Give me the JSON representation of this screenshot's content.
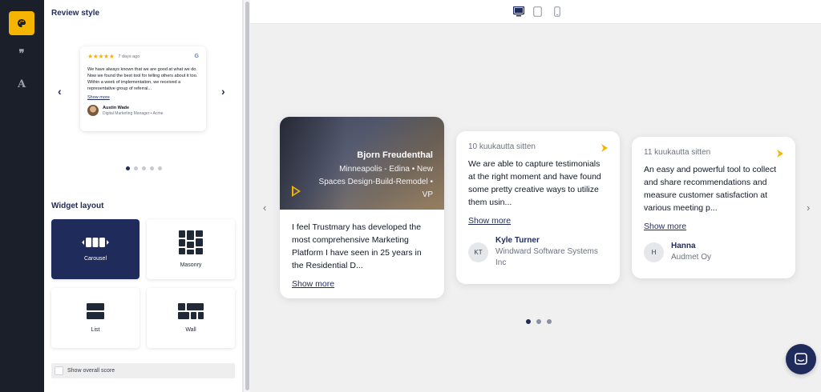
{
  "colors": {
    "accent": "#f5b400",
    "navy": "#1f2b5b",
    "rail": "#1b1f2a"
  },
  "rail": {
    "items": [
      "palette-icon",
      "quote-icon",
      "font-icon"
    ],
    "quote_glyph": "❞",
    "font_glyph": "A"
  },
  "sidebar": {
    "review_style_title": "Review style",
    "preview": {
      "stars": "★★★★★",
      "time": "7 days ago",
      "source": "G",
      "text": "We have always known that we are good at what we do. Now we found the best tool for telling others about it too. Within a week of implementation, we received a representative group of referral...",
      "show_more": "Show more",
      "author_name": "Austin Wade",
      "author_role": "Digital Marketing Manager • Acme",
      "prev": "‹",
      "next": "›",
      "dots": 5,
      "active_dot": 0
    },
    "widget_layout_title": "Widget layout",
    "layouts": [
      {
        "label": "Carousel",
        "active": true
      },
      {
        "label": "Masonry",
        "active": false
      },
      {
        "label": "List",
        "active": false
      },
      {
        "label": "Wall",
        "active": false
      }
    ],
    "show_overall_score": "Show overall score"
  },
  "toolbar": {
    "devices": [
      "desktop-icon",
      "tablet-icon",
      "mobile-icon"
    ],
    "active_device": "desktop-icon"
  },
  "carousel": {
    "prev": "‹",
    "next": "›",
    "cards": [
      {
        "video_name": "Bjorn Freudenthal",
        "video_role": "Minneapolis - Edina • New Spaces Design-Build-Remodel • VP",
        "text": "I feel Trustmary has developed the most comprehensive Marketing Platform I have seen in 25 years in the Residential D...",
        "show_more": "Show more"
      },
      {
        "time": "10 kuukautta sitten",
        "text": "We are able to capture testimonials at the right moment and have found some pretty creative ways to utilize them usin...",
        "show_more": "Show more",
        "initials": "KT",
        "name": "Kyle Turner",
        "company": "Windward Software Systems Inc"
      },
      {
        "time": "11 kuukautta sitten",
        "text": "An easy and powerful tool to collect and share recommendations and measure customer satisfaction at various meeting p...",
        "show_more": "Show more",
        "initials": "H",
        "name": "Hanna",
        "company": "Audmet Oy"
      }
    ],
    "dots": 3,
    "active_dot": 0
  },
  "chat": {
    "icon": "chat-icon"
  }
}
